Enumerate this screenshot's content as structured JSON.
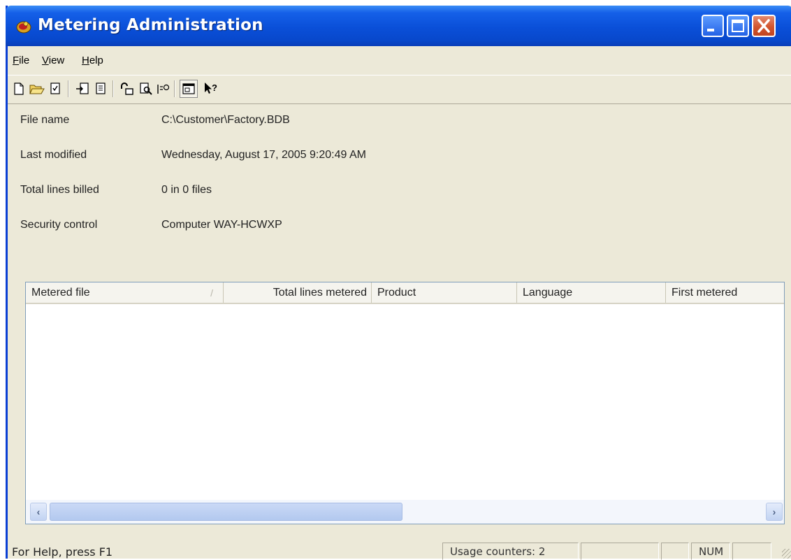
{
  "window": {
    "title": "Metering Administration",
    "colors": {
      "titlebar": "#0a4fd8",
      "face": "#ece9d8",
      "close": "#d2552f"
    }
  },
  "menu": {
    "items": [
      {
        "label": "File",
        "mnemonic": "F"
      },
      {
        "label": "View",
        "mnemonic": "V"
      },
      {
        "label": "Help",
        "mnemonic": "H"
      }
    ]
  },
  "toolbar": {
    "icons": [
      "new-document-icon",
      "open-folder-icon",
      "properties-icon",
      "import-icon",
      "export-icon",
      "unlock-icon",
      "search-document-icon",
      "report-icon",
      "view-toggle-icon",
      "context-help-icon"
    ],
    "pressed": "view-toggle-icon"
  },
  "info": {
    "file_name": {
      "label": "File name",
      "value": "C:\\Customer\\Factory.BDB"
    },
    "last_modified": {
      "label": "Last modified",
      "value": "Wednesday, August 17, 2005 9:20:49 AM"
    },
    "total_lines_billed": {
      "label": "Total lines billed",
      "value": "0 in 0 files"
    },
    "security_control": {
      "label": "Security control",
      "value": "Computer WAY-HCWXP"
    }
  },
  "table": {
    "columns": [
      "Metered file",
      "Total lines metered",
      "Product",
      "Language",
      "First metered"
    ],
    "sort_mark": "/",
    "rows": []
  },
  "statusbar": {
    "help_text": "For Help, press F1",
    "usage_counters": "Usage counters: 2",
    "num_indicator": "NUM"
  }
}
